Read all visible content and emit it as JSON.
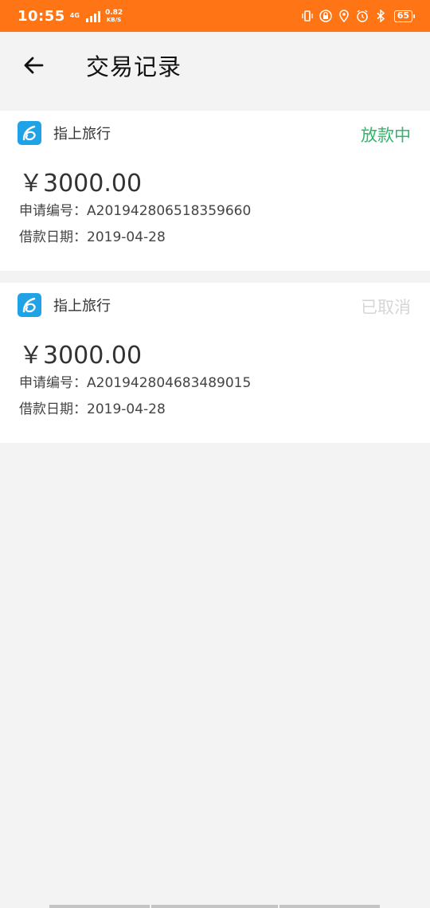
{
  "statusbar": {
    "time": "10:55",
    "network": "4G",
    "speed_value": "0.82",
    "speed_unit": "KB/S",
    "battery": "65"
  },
  "header": {
    "title": "交易记录"
  },
  "records": [
    {
      "merchant": "指上旅行",
      "status": "放款中",
      "status_color": "#2fb86a",
      "amount": "￥3000.00",
      "apply_no": "申请编号：A201942806518359660",
      "loan_date": "借款日期：2019-04-28"
    },
    {
      "merchant": "指上旅行",
      "status": "已取消",
      "status_color": "#d6d6d6",
      "amount": "￥3000.00",
      "apply_no": "申请编号：A201942804683489015",
      "loan_date": "借款日期：2019-04-28"
    }
  ],
  "colors": {
    "statusbar": "#ff7414",
    "background": "#f3f3f3",
    "logo": "#1fa2e6"
  }
}
